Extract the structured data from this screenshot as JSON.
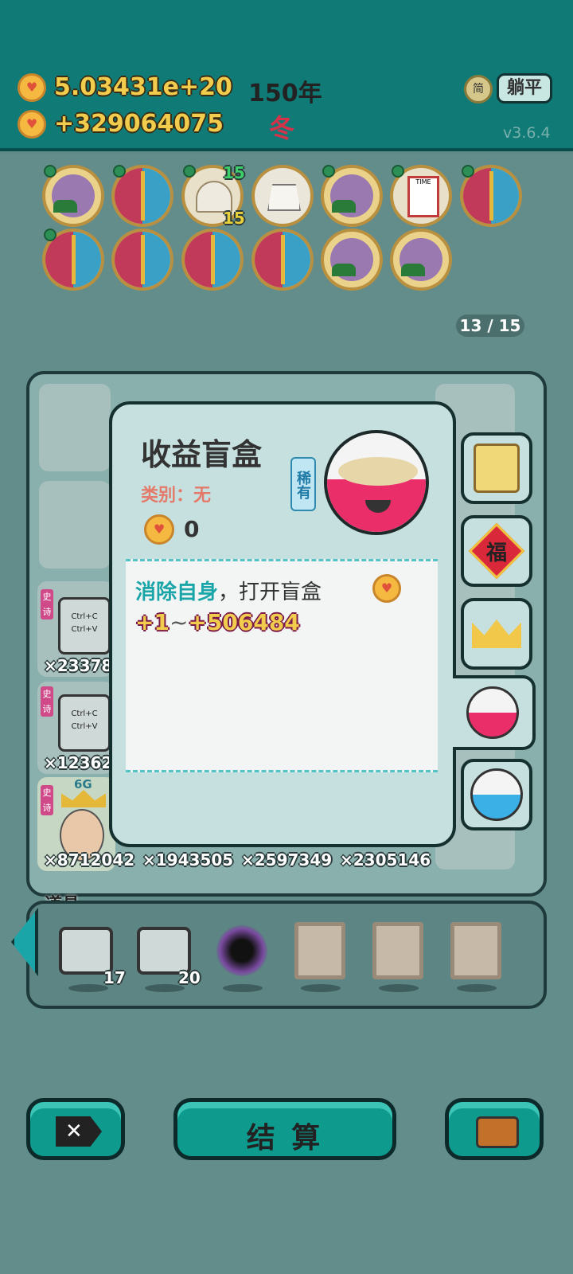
{
  "header": {
    "coins_total": "5.03431e+20",
    "coins_rate": "+329064075",
    "year": "150年",
    "season": "冬",
    "mode_button": "躺平",
    "mode_icon_char": "简",
    "version": "v3.6.4"
  },
  "inventory": {
    "shell_count_top": "15",
    "shell_count_bottom": "15",
    "pager": "13 / 15",
    "time_label": "TIME"
  },
  "board": {
    "counts": [
      "×23378",
      "×12362",
      "×8712042",
      "×1943505",
      "×2597349",
      "×2305146"
    ],
    "epic_label": "史诗",
    "ctrl_c": "Ctrl+C",
    "ctrl_v": "Ctrl+V",
    "badge_6g": "6G"
  },
  "popup": {
    "title": "收益盲盒",
    "rarity": "稀有",
    "category": "类别：无",
    "cost": "0",
    "desc_highlight": "消除自身",
    "desc_rest": "，打开盲盒",
    "reward_min": "+1",
    "reward_sep": "~",
    "reward_max": "+506484"
  },
  "side_tabs": {
    "fu_char": "福"
  },
  "tools": {
    "title": "道具",
    "item1_count": "17",
    "item2_count": "20"
  },
  "buttons": {
    "settle": "结 算"
  },
  "colors": {
    "header_bg": "#0f7a76",
    "popup_bg": "#c6e0df",
    "accent_teal": "#1aa6a8",
    "gold_text": "#f2cc4c"
  }
}
